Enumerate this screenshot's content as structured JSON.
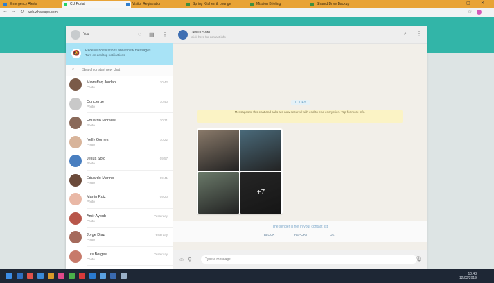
{
  "browser": {
    "tabs": [
      {
        "label": "Emergency Alerts",
        "active": false
      },
      {
        "label": "CU Portal",
        "active": true
      },
      {
        "label": "Visitor Registration",
        "active": false
      },
      {
        "label": "Spring Kitchen & Lounge",
        "active": false
      },
      {
        "label": "Mission Briefing",
        "active": false
      },
      {
        "label": "Shared Drive Backup",
        "active": false
      }
    ],
    "url": "web.whatsapp.com"
  },
  "sidebar": {
    "my_name": "You",
    "notification": {
      "line1": "Receive notifications about new messages",
      "line2": "Turn on desktop notifications"
    },
    "search_placeholder": "Search or start new chat",
    "chats": [
      {
        "name": "Muwaffaq Jordan",
        "preview": "Photo",
        "time": "10:42",
        "avatar": "#7a5a48"
      },
      {
        "name": "Concierge",
        "preview": "Photo",
        "time": "10:40",
        "avatar": "#c9c9c9"
      },
      {
        "name": "Eduardo Morales",
        "preview": "Photo",
        "time": "10:31",
        "avatar": "#8a6a5a"
      },
      {
        "name": "Nelly Gomes",
        "preview": "Photo",
        "time": "10:22",
        "avatar": "#d8b49a"
      },
      {
        "name": "Jesus Soto",
        "preview": "Photo",
        "time": "09:57",
        "avatar": "#4a7fc0"
      },
      {
        "name": "Eduardo Marino",
        "preview": "Photo",
        "time": "09:41",
        "avatar": "#6b4a3a"
      },
      {
        "name": "Martin Ruiz",
        "preview": "Photo",
        "time": "09:20",
        "avatar": "#e9b8a6"
      },
      {
        "name": "Amir Ayoub",
        "preview": "Photo",
        "time": "Yesterday",
        "avatar": "#b8564a"
      },
      {
        "name": "Jorge Diaz",
        "preview": "Photo",
        "time": "Yesterday",
        "avatar": "#a56a5c"
      },
      {
        "name": "Luis Borges",
        "preview": "Photo",
        "time": "Yesterday",
        "avatar": "#c77a6a"
      }
    ]
  },
  "conversation": {
    "title": "Jesus Soto",
    "subtitle": "click here for contact info",
    "date": "TODAY",
    "encryption_line1": "Messages to this chat and calls are now secured with end-to-end encryption. Tap for more info.",
    "encryption_line2": "",
    "photos": [
      {
        "bg": "#8a7a6a"
      },
      {
        "bg": "#4a6a7a"
      },
      {
        "bg": "#6b7a6a"
      },
      {
        "bg": "#3a3a3a"
      }
    ],
    "more_count": "+7",
    "unknown_contact": "The sender is not in your contact list",
    "actions": [
      "BLOCK",
      "REPORT",
      "OK"
    ],
    "compose_placeholder": "Type a message"
  },
  "taskbar": {
    "time": "10:43",
    "date": "12/03/2019"
  }
}
